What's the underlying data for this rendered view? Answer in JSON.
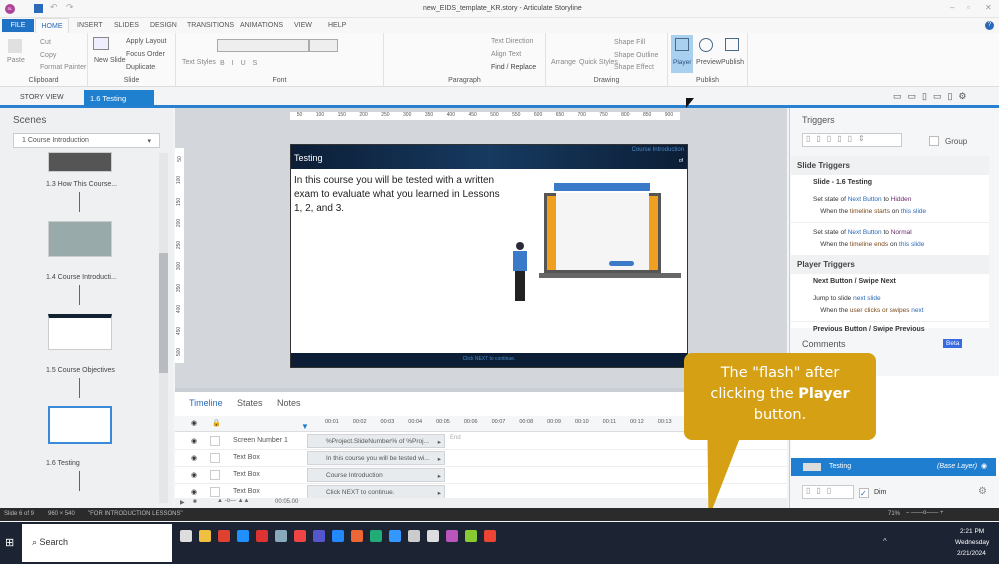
{
  "window": {
    "title": "new_EIDS_template_KR.story - Articulate Storyline",
    "avatar": "SL"
  },
  "ribbon_tabs": [
    "FILE",
    "HOME",
    "INSERT",
    "SLIDES",
    "DESIGN",
    "TRANSITIONS",
    "ANIMATIONS",
    "VIEW",
    "HELP"
  ],
  "ribbon": {
    "clipboard": {
      "label": "Clipboard",
      "paste": "Paste",
      "cut": "Cut",
      "copy": "Copy",
      "format_painter": "Format Painter"
    },
    "slide": {
      "label": "Slide",
      "new_slide": "New Slide",
      "apply_layout": "Apply Layout",
      "focus_order": "Focus Order",
      "duplicate": "Duplicate"
    },
    "font": {
      "label": "Font",
      "text_styles": "Text Styles"
    },
    "paragraph": {
      "label": "Paragraph",
      "text_direction": "Text Direction",
      "align_text": "Align Text",
      "find_replace": "Find / Replace"
    },
    "drawing": {
      "label": "Drawing",
      "arrange": "Arrange",
      "quick_styles": "Quick Styles",
      "shape_fill": "Shape Fill",
      "shape_outline": "Shape Outline",
      "shape_effect": "Shape Effect"
    },
    "publish": {
      "label": "Publish",
      "player": "Player",
      "preview": "Preview",
      "publish": "Publish"
    }
  },
  "doc_tabs": {
    "story_view": "STORY VIEW",
    "active": "1.6 Testing"
  },
  "scenes": {
    "title": "Scenes",
    "selected": "1 Course Introduction",
    "slides": [
      "1.3 How This Course...",
      "1.4 Course Introducti...",
      "1.5 Course Objectives",
      "1.6 Testing"
    ]
  },
  "ruler": [
    "50",
    "100",
    "150",
    "200",
    "250",
    "300",
    "350",
    "400",
    "450",
    "500",
    "550",
    "600",
    "650",
    "700",
    "750",
    "800",
    "850",
    "900"
  ],
  "vruler": [
    "50",
    "100",
    "150",
    "200",
    "250",
    "300",
    "350",
    "400",
    "450",
    "500"
  ],
  "slide": {
    "title": "Testing",
    "section": "Course Introduction",
    "page_of": "of",
    "body": "In this course you will be tested with a written exam to evaluate what you learned in Lessons 1, 2, and 3.",
    "footer": "Click NEXT to continue."
  },
  "timeline": {
    "tabs": [
      "Timeline",
      "States",
      "Notes"
    ],
    "ticks": [
      "00:01",
      "00:02",
      "00:03",
      "00:04",
      "00:05",
      "00:06",
      "00:07",
      "00:08",
      "00:09",
      "00:10",
      "00:11",
      "00:12",
      "00:13"
    ],
    "end": "End",
    "duration": "00:05.00",
    "rows": [
      {
        "name": "Screen Number 1",
        "bar": "%Project.SlideNumber% of %Proj..."
      },
      {
        "name": "Text Box",
        "bar": "In this course you will be tested wi..."
      },
      {
        "name": "Text Box",
        "bar": "Course Introduction"
      },
      {
        "name": "Text Box",
        "bar": "Click NEXT to continue."
      }
    ]
  },
  "triggers": {
    "title": "Triggers",
    "group": "Group",
    "slide_triggers": "Slide Triggers",
    "slide_name": "Slide - 1.6 Testing",
    "t1": {
      "a": "Set state of",
      "obj": "Next Button",
      "to": "to",
      "state": "Hidden",
      "when": "When the",
      "ev": "timeline starts",
      "on": "on",
      "tgt": "this slide"
    },
    "t2": {
      "a": "Set state of",
      "obj": "Next Button",
      "to": "to",
      "state": "Normal",
      "when": "When the",
      "ev": "timeline ends",
      "on": "on",
      "tgt": "this slide"
    },
    "player_triggers": "Player Triggers",
    "next": "Next Button / Swipe Next",
    "t3": {
      "a": "Jump to slide",
      "tgt": "next slide",
      "when": "When the",
      "ev": "user clicks or swipes",
      "nx": "next"
    },
    "prev": "Previous Button / Swipe Previous"
  },
  "comments": {
    "title": "Comments",
    "badge": "Beta"
  },
  "layers": {
    "name": "Testing",
    "base": "(Base Layer)",
    "dim": "Dim"
  },
  "callout": {
    "pre": "The \"flash\" after clicking the ",
    "bold": "Player",
    "post": " button.",
    "color": "#d6a015"
  },
  "status": {
    "slide": "Slide 6 of 9",
    "size": "960 × 540",
    "note": "\"FOR INTRODUCTION LESSONS\"",
    "zoom": "71%"
  },
  "taskbar": {
    "search": "Search",
    "time": "2:21 PM",
    "day": "Wednesday",
    "date": "2/21/2024"
  }
}
